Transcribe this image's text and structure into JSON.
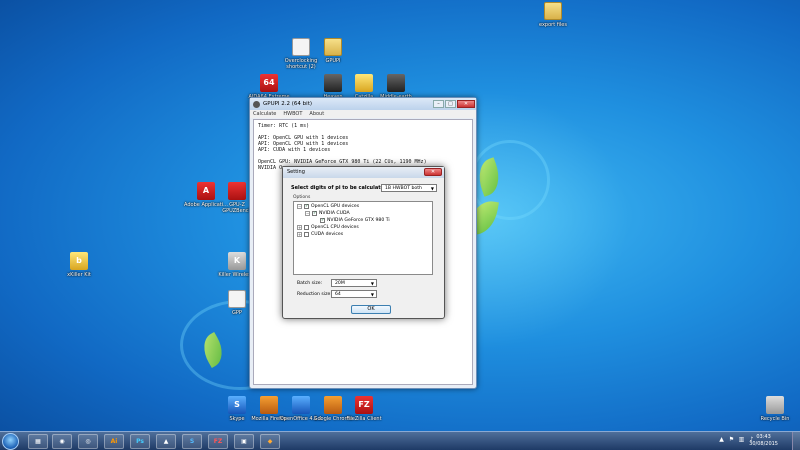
{
  "desktop_icons": {
    "export_files": "export files",
    "overclocking_shortcut": "Overclocking shortcut (2)",
    "gpupi_folder": "GPUPI",
    "aida64": "AIDA64 Extreme",
    "heaven": "Heaven Benchmark",
    "catzilla": "Catzilla",
    "middle_earth": "Middle-earth Shadow of...",
    "adobe": "Adobe Applicati...",
    "gpuz": "GPU-Z GPUZBench",
    "xkill": "xKiller Kit",
    "mfr_winpro": "Killer Wireles...",
    "doc": "GPP",
    "skype": "Skype",
    "firefox": "Mozilla Firefox",
    "openoffice": "OpenOffice 4.1.1",
    "chrome": "Google Chrome",
    "filezilla": "FileZilla Client",
    "recycle": "Recycle Bin"
  },
  "window": {
    "title": "GPUPI 2.2 (64 bit)",
    "menu": [
      "Calculate",
      "HWBOT",
      "About"
    ],
    "console": "Timer: RTC (1 ms)\n\nAPI: OpenCL GPU with 1 devices\nAPI: OpenCL CPU with 1 devices\nAPI: CUDA with 1 devices\n\nOpenCL GPU: NVIDIA GeForce GTX 980 Ti (22 CUs, 1190 MHz)\nNVIDIA Op"
  },
  "dialog": {
    "title": "Setting",
    "digits_label": "Select digits of pi to be calculated:",
    "digits_value": "1B HWBOT both",
    "options_label": "Options",
    "tree": {
      "opencl_gpu": "OpenCL GPU devices",
      "nvidia_cuda": "NVIDIA CUDA",
      "gtx980": "NVIDIA GeForce GTX 980 Ti",
      "opencl_cpu": "OpenCL CPU devices",
      "cuda": "CUDA devices"
    },
    "batch_label": "Batch size:",
    "batch_value": "20M",
    "reduction_label": "Reduction size:",
    "reduction_value": "64",
    "ok_label": "OK"
  },
  "taskbar": {
    "apps": [
      "Explorer",
      "Firefox",
      "Chrome",
      "Illustrator",
      "Photoshop",
      "Paint",
      "Skype",
      "FileZilla",
      "GPUPI",
      "App"
    ],
    "app_glyphs": [
      "▦",
      "◉",
      "◎",
      "Ai",
      "Ps",
      "▲",
      "S",
      "FZ",
      "▣",
      "◆"
    ],
    "time": "03:43",
    "date": "30/08/2015"
  },
  "colors": {
    "accent": "#1f8fdf"
  }
}
